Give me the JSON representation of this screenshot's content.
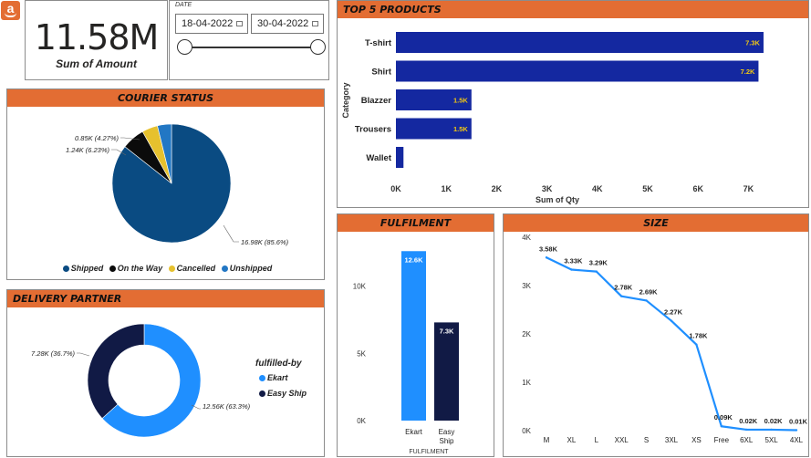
{
  "logo": {
    "glyph": "a"
  },
  "kpi": {
    "value": "11.58M",
    "label": "Sum of Amount"
  },
  "date_filter": {
    "caption": "DATE",
    "start": "18-04-2022",
    "end": "30-04-2022"
  },
  "top5": {
    "title": "TOP 5 PRODUCTS",
    "chart_data": {
      "type": "bar",
      "orientation": "horizontal",
      "categories": [
        "T-shirt",
        "Shirt",
        "Blazzer",
        "Trousers",
        "Wallet"
      ],
      "values": [
        7300,
        7200,
        1500,
        1500,
        150
      ],
      "data_labels": [
        "7.3K",
        "7.2K",
        "1.5K",
        "1.5K",
        ""
      ],
      "xlabel": "Sum of Qty",
      "ylabel": "Category",
      "xlim": [
        0,
        7500
      ],
      "xticks": [
        "0K",
        "1K",
        "2K",
        "3K",
        "4K",
        "5K",
        "6K",
        "7K"
      ],
      "color": "#1428a0",
      "label_color": "#f2c811"
    }
  },
  "courier": {
    "title": "COURIER STATUS",
    "chart_data": {
      "type": "pie",
      "slices": [
        {
          "name": "Shipped",
          "value": 16.98,
          "label": "16.98K (85.6%)",
          "color": "#0a4b82"
        },
        {
          "name": "On the Way",
          "value": 1.24,
          "label": "1.24K (6.23%)",
          "color": "#0b0b0b"
        },
        {
          "name": "Cancelled",
          "value": 0.85,
          "label": "0.85K (4.27%)",
          "color": "#e6c12e"
        },
        {
          "name": "Unshipped",
          "value": 0.76,
          "label": "",
          "color": "#2277c4"
        }
      ],
      "legend": [
        "Shipped",
        "On the Way",
        "Cancelled",
        "Unshipped"
      ],
      "legend_position": "bottom"
    }
  },
  "delivery": {
    "title": "DELIVERY PARTNER",
    "chart_data": {
      "type": "pie",
      "donut": true,
      "slices": [
        {
          "name": "Ekart",
          "value": 12.56,
          "label": "12.56K (63.3%)",
          "color": "#1f8fff"
        },
        {
          "name": "Easy Ship",
          "value": 7.28,
          "label": "7.28K (36.7%)",
          "color": "#111a45"
        }
      ],
      "legend_title": "fulfilled-by",
      "legend": [
        "Ekart",
        "Easy Ship"
      ],
      "legend_position": "right"
    }
  },
  "fulfilment": {
    "title": "FULFILMENT",
    "chart_data": {
      "type": "bar",
      "categories": [
        "Ekart",
        "Easy Ship"
      ],
      "category_lines": [
        [
          "Ekart"
        ],
        [
          "Easy",
          "Ship"
        ]
      ],
      "values": [
        12600,
        7300
      ],
      "data_labels": [
        "12.6K",
        "7.3K"
      ],
      "colors": [
        "#1f8fff",
        "#111a45"
      ],
      "xlabel": "FULFILMENT",
      "ylim": [
        0,
        13500
      ],
      "yticks": [
        {
          "v": 0,
          "t": "0K"
        },
        {
          "v": 5000,
          "t": "5K"
        },
        {
          "v": 10000,
          "t": "10K"
        }
      ]
    }
  },
  "size": {
    "title": "SIZE",
    "chart_data": {
      "type": "line",
      "categories": [
        "M",
        "XL",
        "L",
        "XXL",
        "S",
        "3XL",
        "XS",
        "Free",
        "6XL",
        "5XL",
        "4XL"
      ],
      "values": [
        3580,
        3330,
        3290,
        2780,
        2690,
        2270,
        1780,
        90,
        20,
        20,
        10
      ],
      "data_labels": [
        "3.58K",
        "3.33K",
        "3.29K",
        "2.78K",
        "2.69K",
        "2.27K",
        "1.78K",
        "0.09K",
        "0.02K",
        "0.02K",
        "0.01K"
      ],
      "ylim": [
        0,
        4000
      ],
      "yticks": [
        {
          "v": 0,
          "t": "0K"
        },
        {
          "v": 1000,
          "t": "1K"
        },
        {
          "v": 2000,
          "t": "2K"
        },
        {
          "v": 3000,
          "t": "3K"
        },
        {
          "v": 4000,
          "t": "4K"
        }
      ],
      "color": "#1f8fff"
    }
  }
}
